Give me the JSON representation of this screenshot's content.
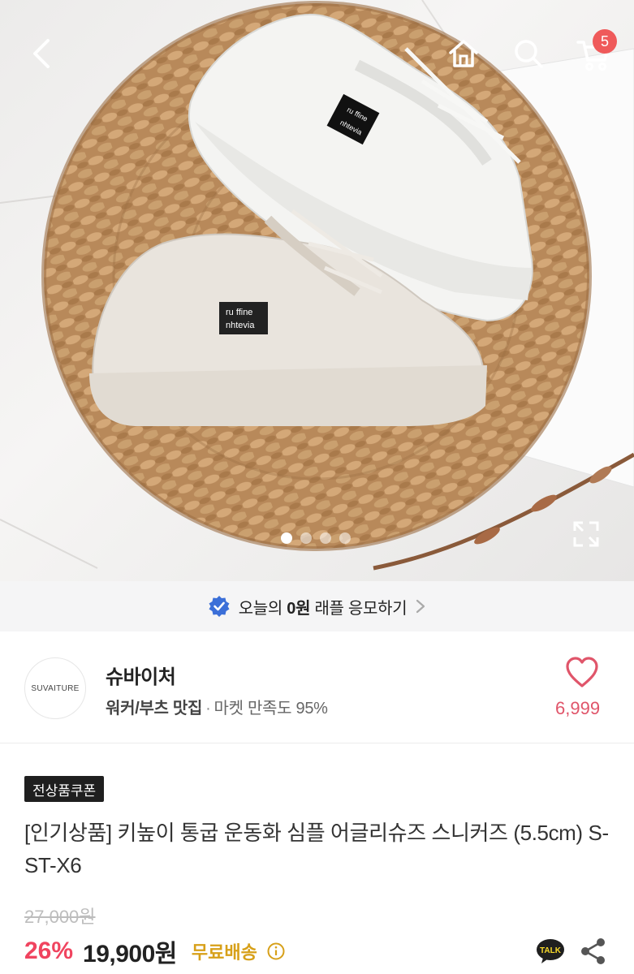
{
  "header": {
    "back_icon": "chevron-left-icon",
    "home_icon": "home-icon",
    "search_icon": "search-icon",
    "cart_icon": "cart-icon",
    "cart_count": "5"
  },
  "gallery": {
    "slide_count": 4,
    "active_slide": 1,
    "shoe_label_line1": "ru ffine",
    "shoe_label_line2": "nhtevia"
  },
  "raffle": {
    "text_pre": "오늘의 ",
    "text_bold": "0원",
    "text_post": " 래플 응모하기"
  },
  "store": {
    "logo_text": "SUVAITURE",
    "name": "슈바이처",
    "category": "워커/부츠 맛집",
    "separator": "·",
    "satisfaction": "마켓 만족도 95%",
    "like_count": "6,999"
  },
  "product": {
    "coupon_badge": "전상품쿠폰",
    "title": "[인기상품] 키높이 통굽 운동화 심플 어글리슈즈 스니커즈 (5.5cm) S-ST-X6",
    "original_price": "27,000원",
    "discount": "26%",
    "price": "19,900원",
    "shipping": "무료배송"
  },
  "colors": {
    "accent_red": "#f0445f",
    "badge_red": "#ef5a5a",
    "shipping_gold": "#d7a019",
    "verified_blue": "#3b6fd8"
  }
}
